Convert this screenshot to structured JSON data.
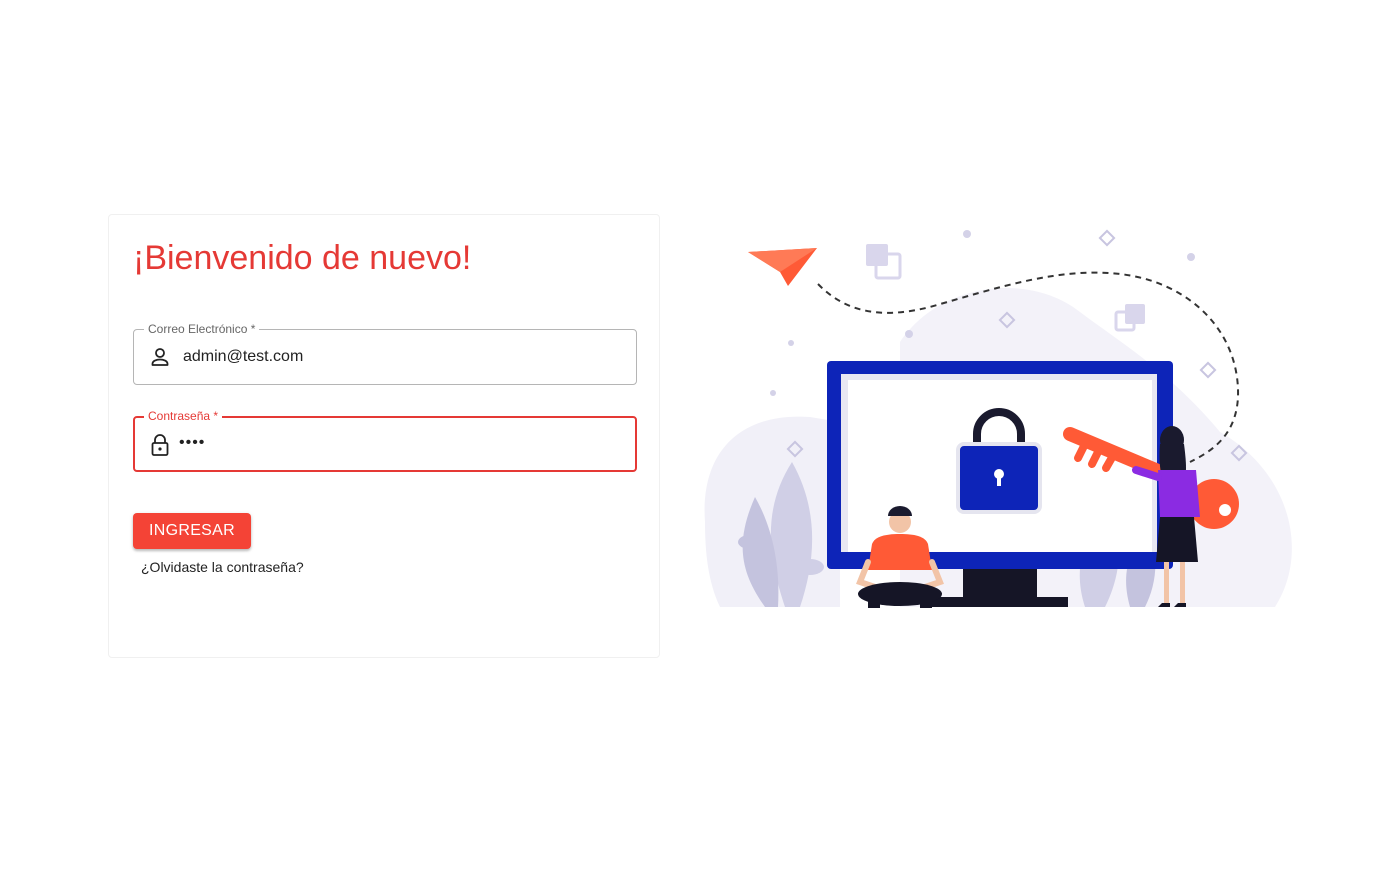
{
  "login": {
    "title": "¡Bienvenido de nuevo!",
    "email": {
      "label": "Correo Electrónico *",
      "value": "admin@test.com",
      "icon": "person-icon"
    },
    "password": {
      "label": "Contraseña *",
      "value": "••••",
      "icon": "lock-icon"
    },
    "submit_label": "INGRESAR",
    "forgot_label": "¿Olvidaste la contraseña?"
  },
  "colors": {
    "accent": "#e53935",
    "button": "#f44336",
    "monitor": "#0d24b8",
    "illustration_orange": "#ff5a36",
    "illustration_purple": "#8b2be2"
  }
}
